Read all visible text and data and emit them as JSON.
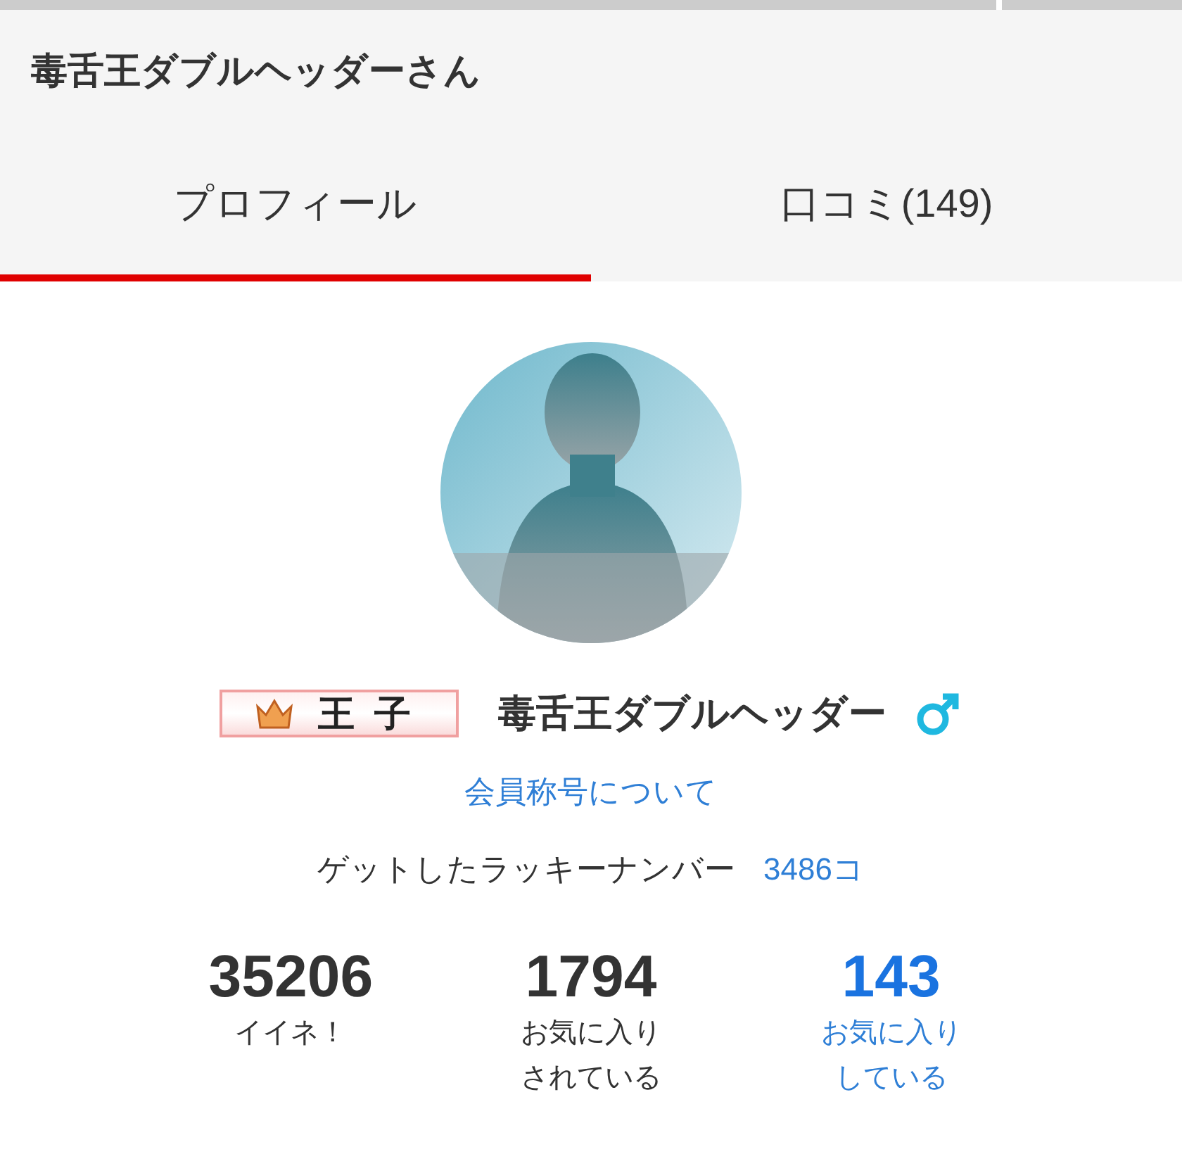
{
  "header": {
    "title": "毒舌王ダブルヘッダーさん"
  },
  "tabs": [
    {
      "label": "プロフィール",
      "selected": true
    },
    {
      "label": "口コミ(149)",
      "selected": false
    }
  ],
  "profile": {
    "rank_badge": "王子",
    "name": "毒舌王ダブルヘッダー",
    "male": true,
    "rank_link": "会員称号について",
    "lucky_label": "ゲットしたラッキーナンバー",
    "lucky_value": "3486コ"
  },
  "stats": [
    {
      "kind": "plain",
      "value": "35206",
      "label_lines": [
        "イイネ！"
      ]
    },
    {
      "kind": "plain",
      "value": "1794",
      "label_lines": [
        "お気に入り",
        "されている"
      ]
    },
    {
      "kind": "link",
      "value": "143",
      "label_lines": [
        "お気に入り",
        "している"
      ]
    }
  ]
}
